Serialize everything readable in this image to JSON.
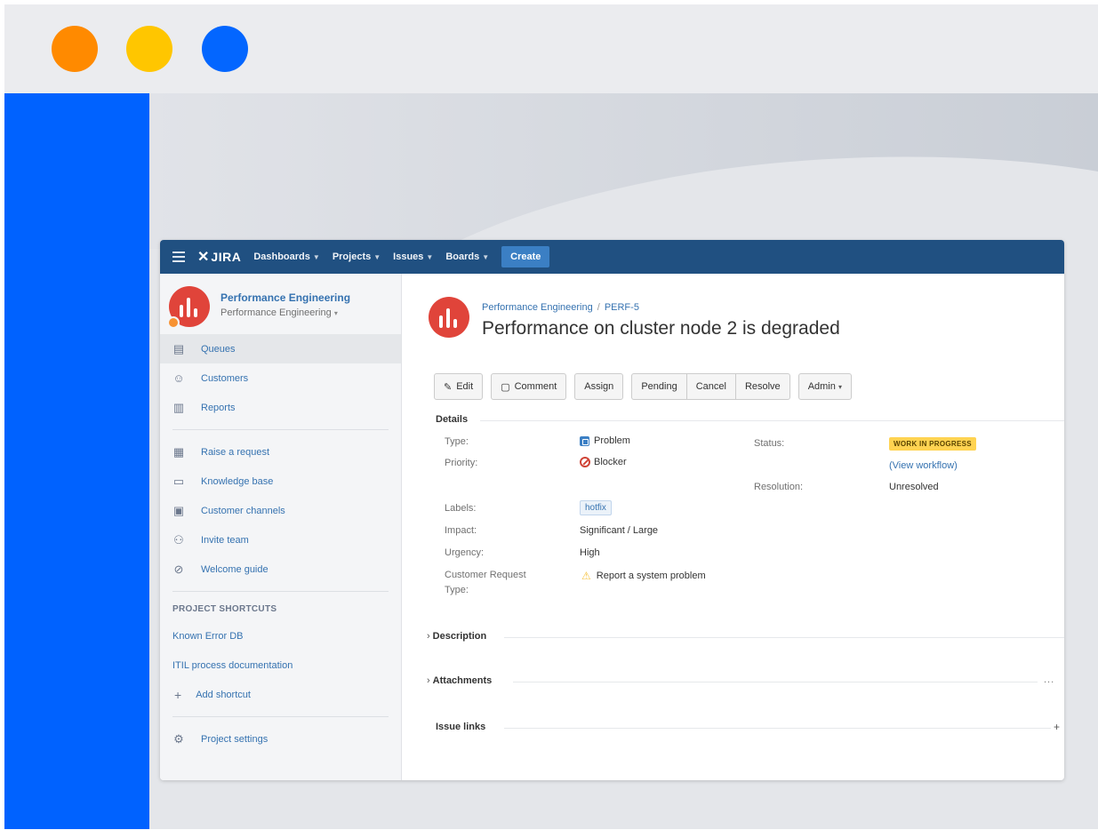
{
  "window": {
    "dots": [
      "#ff8a00",
      "#ffc600",
      "#0366ff"
    ],
    "accent": "#0062ff"
  },
  "navbar": {
    "logo_text": "JIRA",
    "items": [
      {
        "label": "Dashboards"
      },
      {
        "label": "Projects"
      },
      {
        "label": "Issues"
      },
      {
        "label": "Boards"
      }
    ],
    "create_label": "Create",
    "color": "#205081"
  },
  "sidebar": {
    "project_name": "Performance Engineering",
    "project_selector": "Performance Engineering",
    "items": [
      {
        "label": "Queues",
        "icon": "queues-icon"
      },
      {
        "label": "Customers",
        "icon": "customers-icon"
      },
      {
        "label": "Reports",
        "icon": "reports-icon"
      }
    ],
    "items2": [
      {
        "label": "Raise a request",
        "icon": "raise-request-icon"
      },
      {
        "label": "Knowledge base",
        "icon": "knowledge-base-icon"
      },
      {
        "label": "Customer channels",
        "icon": "customer-channels-icon"
      },
      {
        "label": "Invite team",
        "icon": "invite-team-icon"
      },
      {
        "label": "Welcome guide",
        "icon": "compass-icon"
      }
    ],
    "shortcuts_heading": "PROJECT SHORTCUTS",
    "shortcuts": [
      "Known Error DB",
      "ITIL process documentation"
    ],
    "add_shortcut": "Add shortcut",
    "settings": "Project settings"
  },
  "issue": {
    "breadcrumb_project": "Performance Engineering",
    "breadcrumb_sep": "/",
    "breadcrumb_key": "PERF-5",
    "summary": "Performance on cluster node 2 is degraded",
    "actions": {
      "edit": "Edit",
      "comment": "Comment",
      "assign": "Assign",
      "pending": "Pending",
      "cancel": "Cancel",
      "resolve": "Resolve",
      "admin": "Admin"
    },
    "details_title": "Details",
    "fields": {
      "type_label": "Type:",
      "type_value": "Problem",
      "priority_label": "Priority:",
      "priority_value": "Blocker",
      "status_label": "Status:",
      "status_value": "WORK IN PROGRESS",
      "view_workflow": "(View workflow)",
      "resolution_label": "Resolution:",
      "resolution_value": "Unresolved",
      "labels_label": "Labels:",
      "labels_value": "hotfix",
      "impact_label": "Impact:",
      "impact_value": "Significant / Large",
      "urgency_label": "Urgency:",
      "urgency_value": "High",
      "crt_label_1": "Customer Request",
      "crt_label_2": "Type:",
      "crt_value": "Report a system problem"
    },
    "description_title": "Description",
    "attachments_title": "Attachments",
    "attachments_more": "...",
    "issue_links_title": "Issue links",
    "status_color": "#ffd351"
  }
}
